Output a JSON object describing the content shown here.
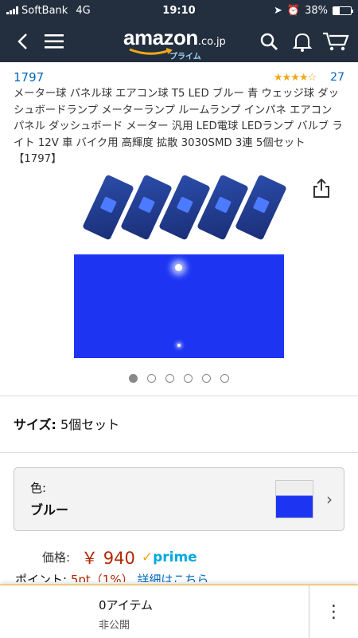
{
  "status_bar": {
    "carrier": "SoftBank",
    "network": "4G",
    "time": "19:10",
    "battery": "38%",
    "battery_level": 0.38
  },
  "header": {
    "logo_text": "amazon",
    "logo_suffix": ".co.jp",
    "logo_sub": "プライム"
  },
  "product": {
    "brand": "1797",
    "rating": 4.5,
    "rating_count": "27",
    "title": "メーター球 パネル球 エアコン球 T5 LED ブルー 青 ウェッジ球 ダッシュボードランプ メーターランプ ルームランプ インパネ エアコン パネル ダッシュボード メーター 汎用 LED電球 LEDランプ バルブ ライト 12V 車 バイク用 高輝度 拡散 3030SMD 3連 5個セット【1797】",
    "image_count": 6,
    "active_image": 0
  },
  "size": {
    "label": "サイズ:",
    "value": "5個セット"
  },
  "variant": {
    "label": "色:",
    "value": "ブルー"
  },
  "price": {
    "label": "価格:",
    "value": "￥ 940",
    "prime": "prime"
  },
  "points": {
    "label": "ポイント:",
    "value": "5pt（1%）",
    "link": "詳細はこちら"
  },
  "bottom_bar": {
    "cart_text": "0アイテム",
    "cart_sub": "非公開"
  },
  "colors": {
    "nav_bg": "#232f3e",
    "link": "#0066c0",
    "price": "#b12704",
    "star": "#f0a81a",
    "prime": "#00a8e1"
  }
}
